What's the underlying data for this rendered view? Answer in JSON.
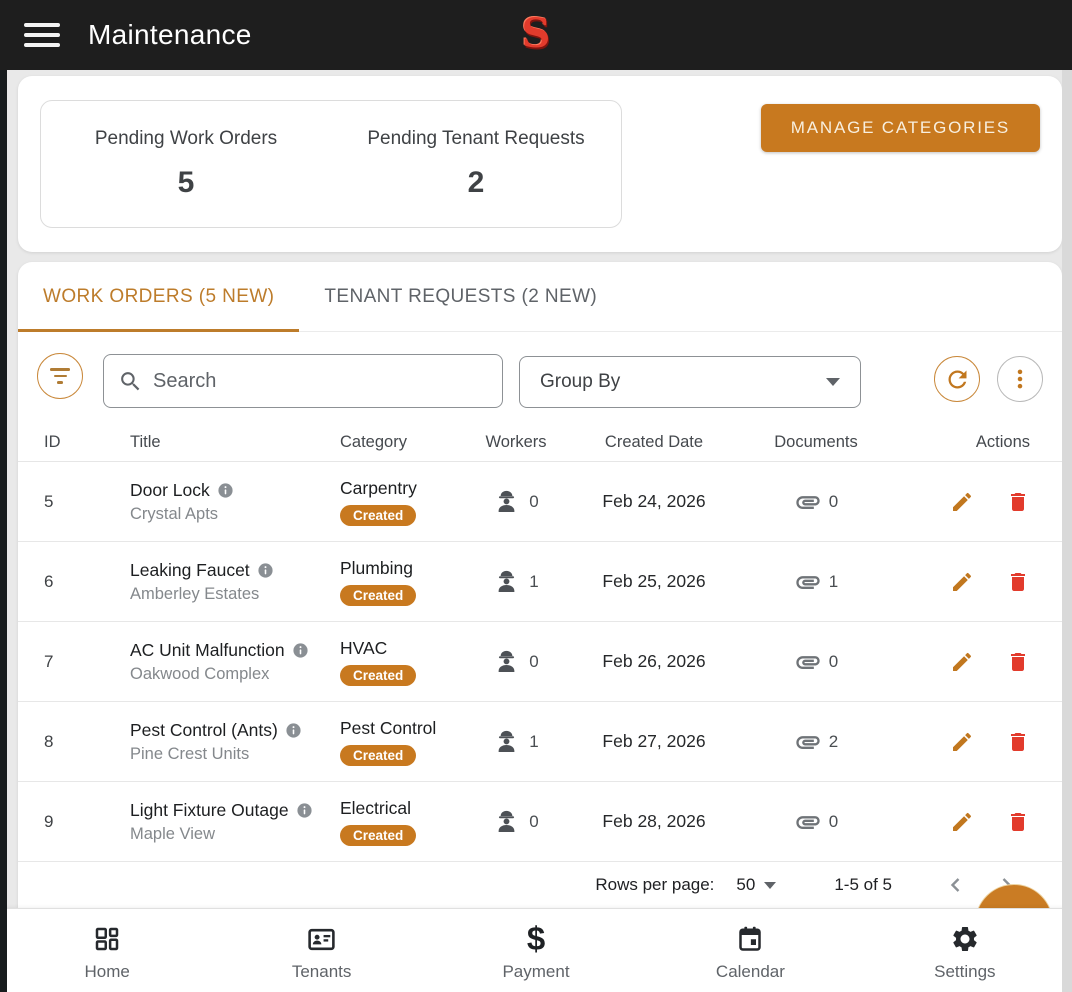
{
  "header": {
    "title": "Maintenance",
    "logo_letter": "S"
  },
  "summary": {
    "stats": [
      {
        "label": "Pending Work Orders",
        "value": "5"
      },
      {
        "label": "Pending Tenant Requests",
        "value": "2"
      }
    ],
    "manage_button": "MANAGE CATEGORIES"
  },
  "tabs": [
    {
      "label": "WORK ORDERS (5 NEW)",
      "active": true
    },
    {
      "label": "TENANT REQUESTS (2 NEW)",
      "active": false
    }
  ],
  "toolbar": {
    "search_placeholder": "Search",
    "group_by_label": "Group By"
  },
  "table": {
    "columns": [
      "ID",
      "Title",
      "Category",
      "Workers",
      "Created Date",
      "Documents",
      "Actions"
    ],
    "rows": [
      {
        "id": "5",
        "title": "Door Lock",
        "property": "Crystal Apts",
        "category": "Carpentry",
        "status": "Created",
        "workers": "0",
        "created": "Feb 24, 2026",
        "documents": "0"
      },
      {
        "id": "6",
        "title": "Leaking Faucet",
        "property": "Amberley Estates",
        "category": "Plumbing",
        "status": "Created",
        "workers": "1",
        "created": "Feb 25, 2026",
        "documents": "1"
      },
      {
        "id": "7",
        "title": "AC Unit Malfunction",
        "property": "Oakwood Complex",
        "category": "HVAC",
        "status": "Created",
        "workers": "0",
        "created": "Feb 26, 2026",
        "documents": "0"
      },
      {
        "id": "8",
        "title": "Pest Control (Ants)",
        "property": "Pine Crest Units",
        "category": "Pest Control",
        "status": "Created",
        "workers": "1",
        "created": "Feb 27, 2026",
        "documents": "2"
      },
      {
        "id": "9",
        "title": "Light Fixture Outage",
        "property": "Maple View",
        "category": "Electrical",
        "status": "Created",
        "workers": "0",
        "created": "Feb 28, 2026",
        "documents": "0"
      }
    ]
  },
  "pagination": {
    "rows_per_page_label": "Rows per page:",
    "rows_per_page_value": "50",
    "range": "1-5 of 5"
  },
  "bottom_nav": [
    {
      "label": "Home"
    },
    {
      "label": "Tenants"
    },
    {
      "label": "Payment"
    },
    {
      "label": "Calendar"
    },
    {
      "label": "Settings"
    }
  ],
  "icons": {
    "header": [
      "hamburger-menu-icon",
      "dollar-logo"
    ],
    "toolbar": [
      "filter-icon",
      "search-icon",
      "chevron-down-icon",
      "refresh-icon",
      "more-vert-icon"
    ],
    "row": [
      "info-icon",
      "worker-icon",
      "paperclip-icon",
      "pencil-icon",
      "trash-icon"
    ],
    "bottom_nav": [
      "dashboard-icon",
      "contact-card-icon",
      "dollar-icon",
      "calendar-icon",
      "gear-icon"
    ]
  },
  "colors": {
    "accent": "#c8791f",
    "danger": "#e23b2c",
    "header_bg": "#1e1e1e",
    "tab_active": "#bd7c2b"
  }
}
